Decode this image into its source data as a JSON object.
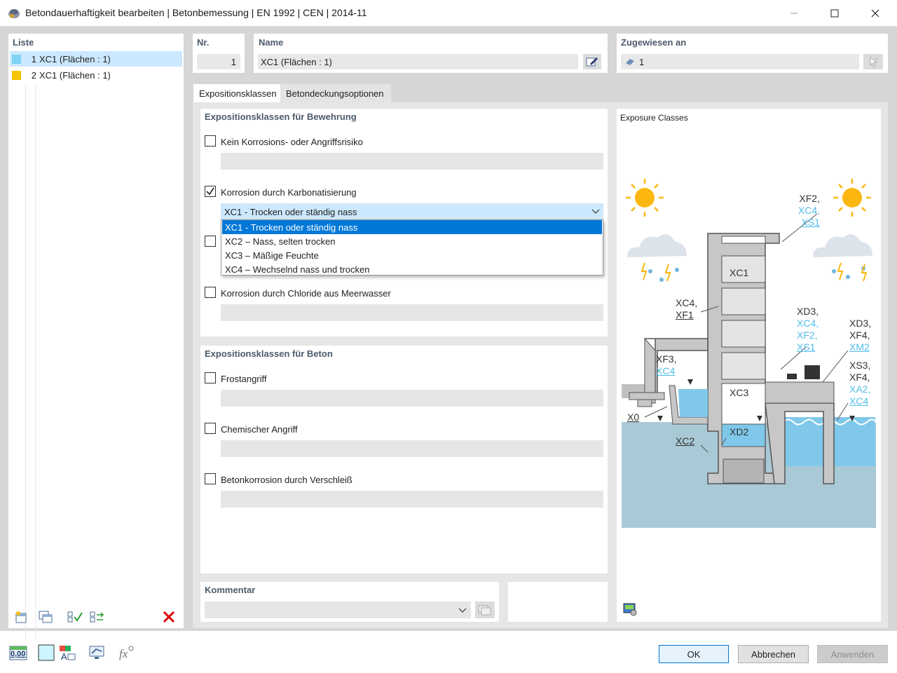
{
  "window": {
    "title": "Betondauerhaftigkeit bearbeiten | Betonbemessung | EN 1992 | CEN | 2014-11",
    "minimize_icon": "minimize-icon",
    "maximize_icon": "maximize-icon",
    "close_icon": "close-icon"
  },
  "list": {
    "header": "Liste",
    "items": [
      {
        "num": "1",
        "label": "XC1 (Flächen : 1)",
        "color": "#7fd3f2"
      },
      {
        "num": "2",
        "label": "XC1 (Flächen : 1)",
        "color": "#f5c400"
      }
    ]
  },
  "nr": {
    "label": "Nr.",
    "value": "1"
  },
  "name": {
    "label": "Name",
    "value": "XC1 (Flächen : 1)"
  },
  "assigned": {
    "label": "Zugewiesen an",
    "value": "1"
  },
  "tabs": [
    {
      "label": "Expositionsklassen"
    },
    {
      "label": "Betondeckungsoptionen"
    }
  ],
  "reinforcement": {
    "title": "Expositionsklassen für Bewehrung",
    "no_risk": {
      "label": "Kein Korrosions- oder Angriffsrisiko",
      "checked": false
    },
    "carbonation": {
      "label": "Korrosion durch Karbonatisierung",
      "checked": true
    },
    "selected": "XC1 - Trocken oder ständig nass",
    "options": [
      "XC1 - Trocken oder ständig nass",
      "XC2 – Nass, selten trocken",
      "XC3 – Mäßige Feuchte",
      "XC4 – Wechselnd nass und trocken"
    ],
    "chlorides_sea": {
      "label": "Korrosion durch Chloride aus Meerwasser",
      "checked": false
    }
  },
  "concrete": {
    "title": "Expositionsklassen für Beton",
    "frost": {
      "label": "Frostangriff",
      "checked": false
    },
    "chemical": {
      "label": "Chemischer Angriff",
      "checked": false
    },
    "abrasion": {
      "label": "Betonkorrosion durch Verschleiß",
      "checked": false
    }
  },
  "comment": {
    "label": "Kommentar",
    "value": ""
  },
  "figure": {
    "title": "Exposure Classes",
    "labels": {
      "top_right": [
        "XF2,",
        "XC4,",
        "XS1"
      ],
      "xc1": "XC1",
      "mid_left": [
        "XC4,",
        "XF1"
      ],
      "mid_right1": [
        "XD3,",
        "XC4,",
        "XF2,",
        "XS1"
      ],
      "mid_right2": [
        "XD3,",
        "XF4,",
        "XM2"
      ],
      "right_low": [
        "XS3,",
        "XF4,",
        "XA2,",
        "XC4"
      ],
      "basin": [
        "XF3,",
        "XC4"
      ],
      "xc3": "XC3",
      "xd2": "XD2",
      "x0": "X0",
      "xc2": "XC2"
    }
  },
  "buttons": {
    "ok": "OK",
    "cancel": "Abbrechen",
    "apply": "Anwenden"
  },
  "bottom_icons": {
    "units": "0,00"
  },
  "colors": {
    "selection": "#cce8ff",
    "highlight": "#0078d7",
    "header_text": "#4d5a6b",
    "water": "#7fc8ea",
    "ground": "#a8c8d6",
    "structure": "#c8c8c8",
    "delete": "#e00000"
  }
}
